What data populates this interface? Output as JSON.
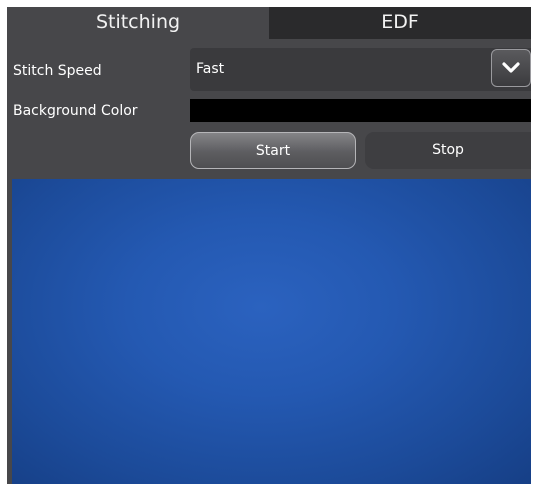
{
  "tabs": [
    {
      "label": "Stitching",
      "active": true
    },
    {
      "label": "EDF",
      "active": false
    }
  ],
  "stitch_speed": {
    "label": "Stitch Speed",
    "value": "Fast",
    "dropdown_icon": "chevron-down-icon"
  },
  "background_color": {
    "label": "Background Color",
    "value": "#000000"
  },
  "buttons": {
    "start": "Start",
    "stop": "Stop"
  },
  "colors": {
    "panel": "#47474a",
    "tab_inactive": "#2a2a2c",
    "canvas": "#2459b2"
  }
}
